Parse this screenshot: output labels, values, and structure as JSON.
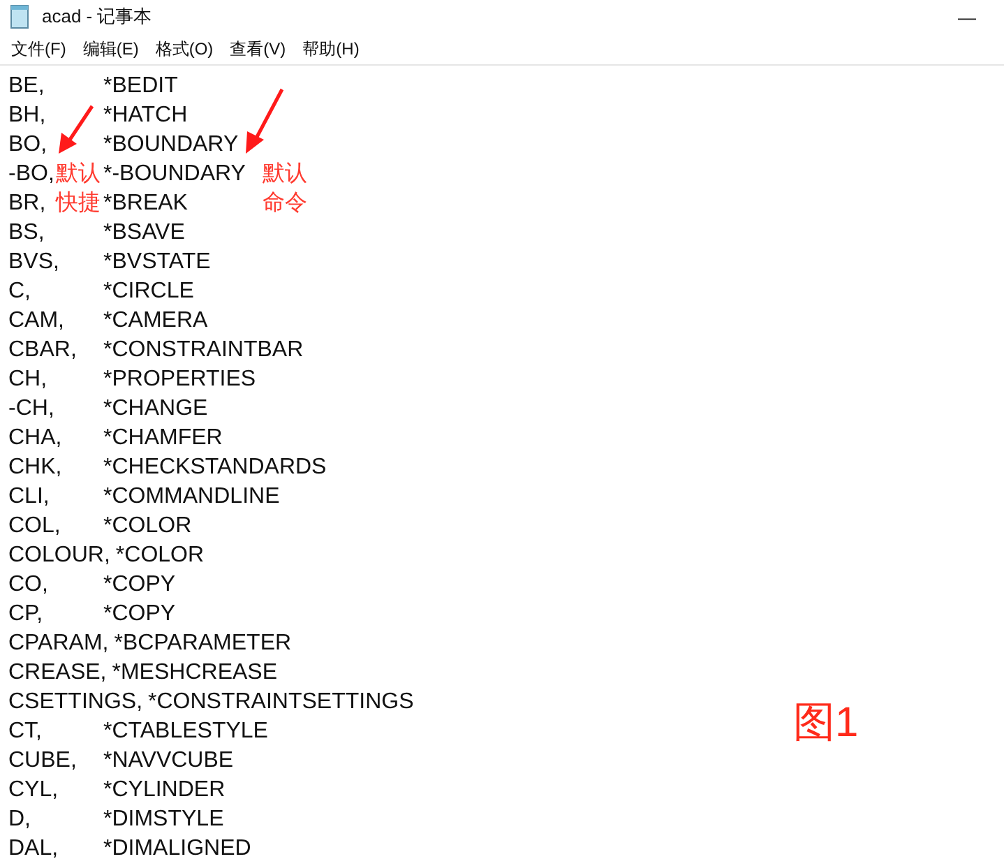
{
  "window": {
    "title": "acad - 记事本",
    "minimize": "—"
  },
  "menu": [
    {
      "label": "文件(F)"
    },
    {
      "label": "编辑(E)"
    },
    {
      "label": "格式(O)"
    },
    {
      "label": "查看(V)"
    },
    {
      "label": "帮助(H)"
    }
  ],
  "lines": [
    {
      "alias": "BE,",
      "command": "*BEDIT"
    },
    {
      "alias": "BH,",
      "command": "*HATCH"
    },
    {
      "alias": "BO,",
      "command": "*BOUNDARY"
    },
    {
      "alias": "-BO,",
      "command": "*-BOUNDARY"
    },
    {
      "alias": "BR,",
      "command": "*BREAK"
    },
    {
      "alias": "BS,",
      "command": "*BSAVE"
    },
    {
      "alias": "BVS,",
      "command": "*BVSTATE"
    },
    {
      "alias": "C,",
      "command": "*CIRCLE"
    },
    {
      "alias": "CAM,",
      "command": "*CAMERA"
    },
    {
      "alias": "CBAR,",
      "command": "*CONSTRAINTBAR"
    },
    {
      "alias": "CH,",
      "command": "*PROPERTIES"
    },
    {
      "alias": "-CH,",
      "command": "*CHANGE"
    },
    {
      "alias": "CHA,",
      "command": "*CHAMFER"
    },
    {
      "alias": "CHK,",
      "command": "*CHECKSTANDARDS"
    },
    {
      "alias": "CLI,",
      "command": "*COMMANDLINE"
    },
    {
      "alias": "COL,",
      "command": "*COLOR"
    },
    {
      "alias": "COLOUR,",
      "command": "*COLOR"
    },
    {
      "alias": "CO,",
      "command": "*COPY"
    },
    {
      "alias": "CP,",
      "command": "*COPY"
    },
    {
      "alias": "CPARAM,",
      "command": "*BCPARAMETER"
    },
    {
      "alias": "CREASE,",
      "command": "*MESHCREASE"
    },
    {
      "alias": "CSETTINGS,",
      "command": "*CONSTRAINTSETTINGS"
    },
    {
      "alias": "CT,",
      "command": "*CTABLESTYLE"
    },
    {
      "alias": "CUBE,",
      "command": "*NAVVCUBE"
    },
    {
      "alias": "CYL,",
      "command": "*CYLINDER"
    },
    {
      "alias": "D,",
      "command": "*DIMSTYLE"
    },
    {
      "alias": "DAL,",
      "command": "*DIMALIGNED"
    }
  ],
  "annotations": [
    {
      "kind": "arrow-label",
      "lines": [
        "默认",
        "快捷"
      ]
    },
    {
      "kind": "arrow-label",
      "lines": [
        "默认",
        "命令"
      ]
    },
    {
      "kind": "caption",
      "lines": [
        "图1"
      ]
    }
  ]
}
